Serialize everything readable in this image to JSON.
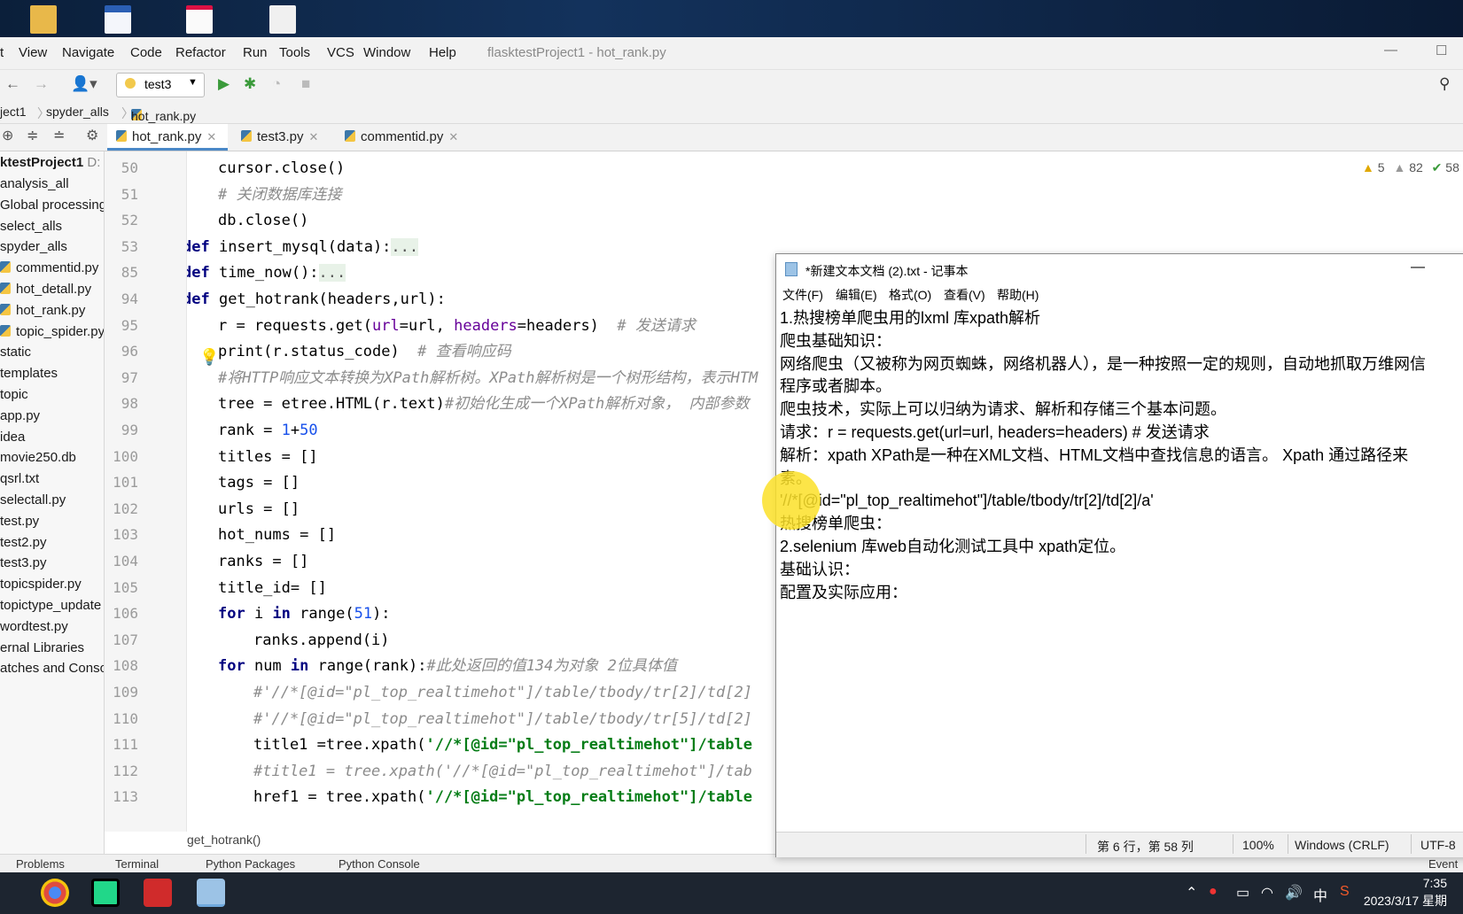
{
  "menubar": {
    "items": [
      "t",
      "View",
      "Navigate",
      "Code",
      "Refactor",
      "Run",
      "Tools",
      "VCS",
      "Window",
      "Help"
    ],
    "window_title": "flasktestProject1 - hot_rank.py"
  },
  "toolbar": {
    "run_config": "test3"
  },
  "breadcrumb": [
    "ject1",
    "spyder_alls",
    "hot_rank.py"
  ],
  "tabs": [
    {
      "label": "hot_rank.py",
      "active": true
    },
    {
      "label": "test3.py",
      "active": false
    },
    {
      "label": "commentid.py",
      "active": false
    }
  ],
  "project_tree": {
    "root": "ktestProject1",
    "root_path": "D:",
    "items": [
      "analysis_all",
      "Global processing",
      "select_alls",
      "spyder_alls",
      "commentid.py",
      "hot_detall.py",
      "hot_rank.py",
      "topic_spider.py",
      "static",
      "templates",
      "topic",
      "app.py",
      "idea",
      "movie250.db",
      "qsrl.txt",
      "selectall.py",
      "test.py",
      "test2.py",
      "test3.py",
      "topicspider.py",
      "topictype_update",
      "wordtest.py",
      "ernal Libraries",
      "atches and Consoles"
    ]
  },
  "editor": {
    "current_line": "96",
    "lines": [
      {
        "n": "50",
        "indent": 1,
        "parts": [
          [
            "",
            "cursor.close()"
          ]
        ]
      },
      {
        "n": "51",
        "indent": 1,
        "parts": [
          [
            "cm",
            "# 关闭数据库连接"
          ]
        ]
      },
      {
        "n": "52",
        "indent": 1,
        "parts": [
          [
            "",
            "db.close()"
          ]
        ]
      },
      {
        "n": "53",
        "indent": 0,
        "parts": [
          [
            "kw",
            "def "
          ],
          [
            "",
            "insert_mysql(data):"
          ],
          [
            "fold",
            "..."
          ]
        ]
      },
      {
        "n": "85",
        "indent": 0,
        "parts": [
          [
            "kw",
            "def "
          ],
          [
            "",
            "time_now():"
          ],
          [
            "fold",
            "..."
          ]
        ]
      },
      {
        "n": "94",
        "indent": 0,
        "parts": [
          [
            "kw",
            "def "
          ],
          [
            "",
            "get_hotrank(headers,url):"
          ]
        ]
      },
      {
        "n": "95",
        "indent": 1,
        "parts": [
          [
            "",
            "r = requests.get("
          ],
          [
            "pa",
            "url"
          ],
          [
            "",
            "=url, "
          ],
          [
            "pa",
            "headers"
          ],
          [
            "",
            "=headers)  "
          ],
          [
            "cm",
            "# 发送请求"
          ]
        ]
      },
      {
        "n": "96",
        "indent": 1,
        "parts": [
          [
            "",
            "print(r.status_code)  "
          ],
          [
            "cm",
            "# 查看响应码"
          ]
        ]
      },
      {
        "n": "97",
        "indent": 1,
        "parts": [
          [
            "cm",
            "#将HTTP响应文本转换为XPath解析树。XPath解析树是一个树形结构，表示HTM"
          ]
        ]
      },
      {
        "n": "98",
        "indent": 1,
        "parts": [
          [
            "",
            "tree = etree.HTML(r.text)"
          ],
          [
            "cm",
            "#初始化生成一个XPath解析对象， 内部参数"
          ]
        ]
      },
      {
        "n": "99",
        "indent": 1,
        "parts": [
          [
            "",
            "rank = "
          ],
          [
            "nu",
            "1"
          ],
          [
            "",
            "+"
          ],
          [
            "nu",
            "50"
          ]
        ]
      },
      {
        "n": "100",
        "indent": 1,
        "parts": [
          [
            "",
            "titles = []"
          ]
        ]
      },
      {
        "n": "101",
        "indent": 1,
        "parts": [
          [
            "",
            "tags = []"
          ]
        ]
      },
      {
        "n": "102",
        "indent": 1,
        "parts": [
          [
            "",
            "urls = []"
          ]
        ]
      },
      {
        "n": "103",
        "indent": 1,
        "parts": [
          [
            "",
            "hot_nums = []"
          ]
        ]
      },
      {
        "n": "104",
        "indent": 1,
        "parts": [
          [
            "",
            "ranks = []"
          ]
        ]
      },
      {
        "n": "105",
        "indent": 1,
        "parts": [
          [
            "",
            "title_id= []"
          ]
        ]
      },
      {
        "n": "106",
        "indent": 1,
        "parts": [
          [
            "kw",
            "for "
          ],
          [
            "",
            "i "
          ],
          [
            "kw",
            "in "
          ],
          [
            "",
            "range("
          ],
          [
            "nu",
            "51"
          ],
          [
            "",
            "):"
          ]
        ]
      },
      {
        "n": "107",
        "indent": 2,
        "parts": [
          [
            "",
            "ranks.append(i)"
          ]
        ]
      },
      {
        "n": "108",
        "indent": 1,
        "parts": [
          [
            "kw",
            "for "
          ],
          [
            "",
            "num "
          ],
          [
            "kw",
            "in "
          ],
          [
            "",
            "range(rank):"
          ],
          [
            "cm",
            "#此处返回的值134为对象 2位具体值"
          ]
        ]
      },
      {
        "n": "109",
        "indent": 2,
        "parts": [
          [
            "cm",
            "#'//*[@id=\"pl_top_realtimehot\"]/table/tbody/tr[2]/td[2]"
          ]
        ]
      },
      {
        "n": "110",
        "indent": 2,
        "parts": [
          [
            "cm",
            "#'//*[@id=\"pl_top_realtimehot\"]/table/tbody/tr[5]/td[2]"
          ]
        ]
      },
      {
        "n": "111",
        "indent": 2,
        "parts": [
          [
            "",
            "title1 =tree.xpath("
          ],
          [
            "st",
            "'//*[@id=\"pl_top_realtimehot\"]/table"
          ]
        ]
      },
      {
        "n": "112",
        "indent": 2,
        "parts": [
          [
            "cm",
            "#title1 = tree.xpath('//*[@id=\"pl_top_realtimehot\"]/tab"
          ]
        ]
      },
      {
        "n": "113",
        "indent": 2,
        "parts": [
          [
            "",
            "href1 = tree.xpath("
          ],
          [
            "st",
            "'//*[@id=\"pl_top_realtimehot\"]/table"
          ]
        ]
      }
    ]
  },
  "status_function": "get_hotrank()",
  "inspections": {
    "warnings": "5",
    "weak": "82",
    "ok": "58"
  },
  "bottom_tabs": [
    "Problems",
    "Terminal",
    "Python Packages",
    "Python Console",
    "Event"
  ],
  "notepad": {
    "title": "*新建文本文档 (2).txt - 记事本",
    "menu": [
      "文件(F)",
      "编辑(E)",
      "格式(O)",
      "查看(V)",
      "帮助(H)"
    ],
    "lines": [
      "1.热搜榜单爬虫用的lxml 库xpath解析",
      "爬虫基础知识：",
      "网络爬虫（又被称为网页蜘蛛，网络机器人），是一种按照一定的规则，自动地抓取万维网信",
      "程序或者脚本。",
      "爬虫技术，实际上可以归纳为请求、解析和存储三个基本问题。",
      "请求：r = requests.get(url=url, headers=headers)  # 发送请求",
      "解析：xpath  XPath是一种在XML文档、HTML文档中查找信息的语言。 Xpath 通过路径来",
      "素。",
      "'//*[@id=\"pl_top_realtimehot\"]/table/tbody/tr[2]/td[2]/a'",
      "热搜榜单爬虫：",
      "2.selenium 库web自动化测试工具中 xpath定位。",
      "基础认识：",
      "配置及实际应用："
    ],
    "status": {
      "position": "第 6 行，第 58 列",
      "zoom": "100%",
      "eol": "Windows (CRLF)",
      "encoding": "UTF-8"
    }
  },
  "taskbar": {
    "time": "7:35",
    "date": "2023/3/17 星期",
    "ime": "中"
  }
}
